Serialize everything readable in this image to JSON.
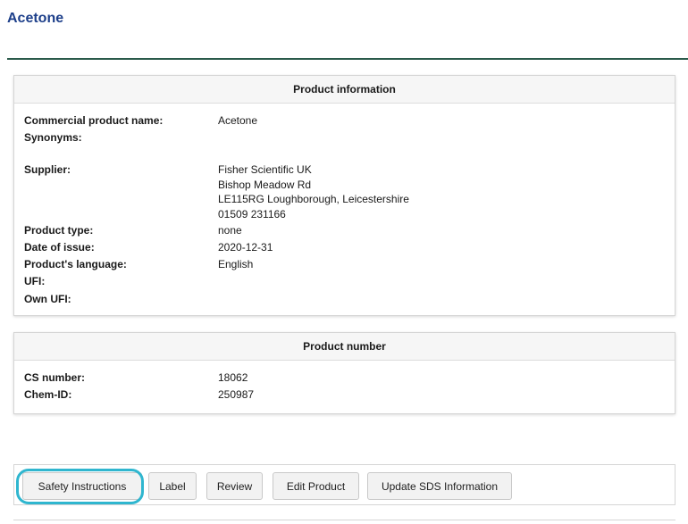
{
  "page": {
    "title": "Acetone"
  },
  "product_information": {
    "header": "Product information",
    "rows": [
      {
        "label": "Commercial product name:",
        "value": [
          "Acetone"
        ]
      },
      {
        "label": "Synonyms:",
        "value": []
      },
      {
        "label": "Supplier:",
        "value": [
          "Fisher Scientific UK",
          "Bishop Meadow Rd",
          "LE115RG Loughborough, Leicestershire",
          "01509 231166"
        ]
      },
      {
        "label": "Product type:",
        "value": [
          "none"
        ]
      },
      {
        "label": "Date of issue:",
        "value": [
          "2020-12-31"
        ]
      },
      {
        "label": "Product's language:",
        "value": [
          "English"
        ]
      },
      {
        "label": "UFI:",
        "value": []
      },
      {
        "label": "Own UFI:",
        "value": []
      }
    ]
  },
  "product_number": {
    "header": "Product number",
    "rows": [
      {
        "label": "CS number:",
        "value": [
          "18062"
        ]
      },
      {
        "label": "Chem-ID:",
        "value": [
          "250987"
        ]
      }
    ]
  },
  "actions": {
    "safety_instructions": "Safety Instructions",
    "label": "Label",
    "review": "Review",
    "edit_product": "Edit Product",
    "update_sds": "Update SDS Information"
  },
  "colors": {
    "title": "#1d3f8a",
    "rule": "#2a5a4a",
    "highlight": "#2fb6cf"
  }
}
